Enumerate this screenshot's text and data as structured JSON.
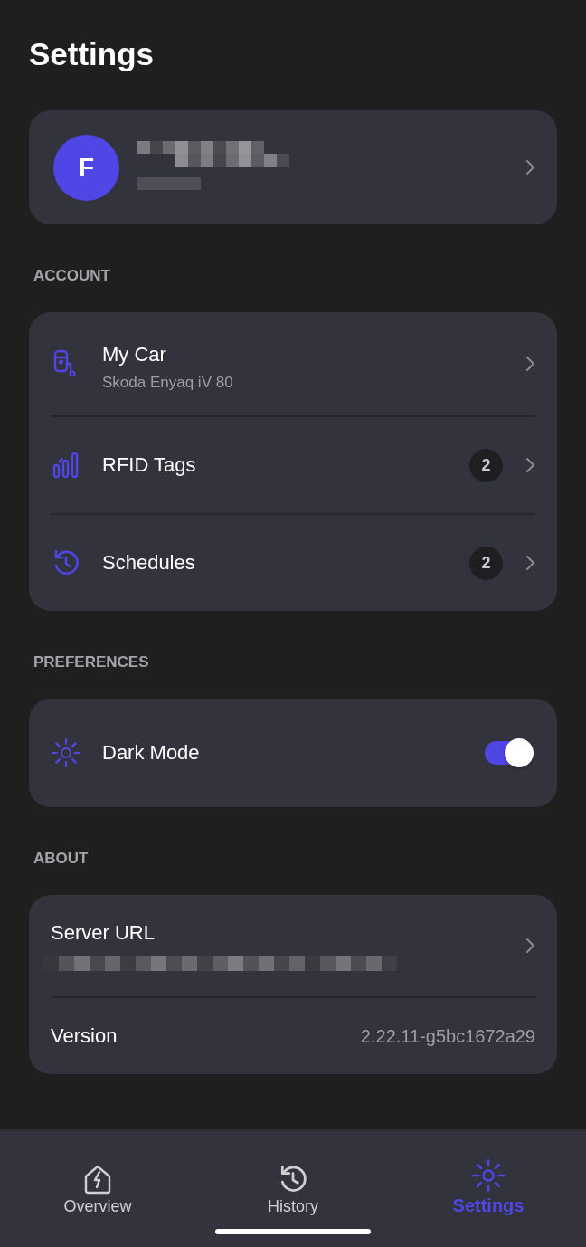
{
  "title": "Settings",
  "profile": {
    "avatar": "F"
  },
  "sections": [
    {
      "header": "ACCOUNT",
      "rows": [
        {
          "kind": "link",
          "label": "My Car",
          "sublabel": "Skoda Enyaq iV 80"
        },
        {
          "kind": "link",
          "label": "RFID Tags",
          "badge": "2"
        },
        {
          "kind": "link",
          "label": "Schedules",
          "badge": "2"
        }
      ]
    },
    {
      "header": "PREFERENCES",
      "rows": [
        {
          "kind": "toggle",
          "label": "Dark Mode",
          "on": true
        }
      ]
    },
    {
      "header": "ABOUT",
      "rows": [
        {
          "kind": "hidden-link",
          "label": "Server URL"
        },
        {
          "kind": "value",
          "label": "Version",
          "value": "2.22.11-g5bc1672a29"
        }
      ]
    }
  ],
  "nav": [
    {
      "label": "Overview",
      "selected": false
    },
    {
      "label": "History",
      "selected": false
    },
    {
      "label": "Settings",
      "selected": true
    }
  ]
}
